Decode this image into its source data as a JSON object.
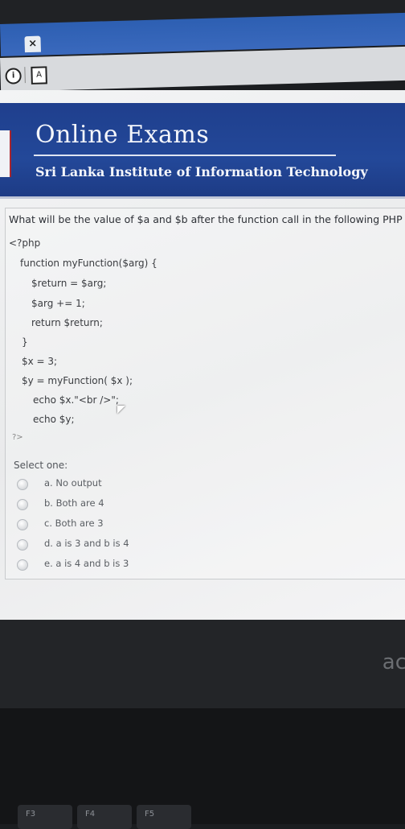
{
  "browser": {
    "tab_close": "×",
    "info_icon": "i",
    "page_icon": "A"
  },
  "banner": {
    "title": "Online Exams",
    "subtitle": "Sri Lanka Institute of Information Technology"
  },
  "question": {
    "text": "What will be the value of $a and $b after the function call in the following PHP",
    "code": [
      "<?php",
      "function myFunction($arg) {",
      "$return = $arg;",
      "$arg += 1;",
      "return $return;",
      "}",
      "$x = 3;",
      "$y = myFunction( $x );",
      "echo $x.\"<br />\";",
      "echo $y;",
      "?>"
    ],
    "select_label": "Select one:",
    "options": [
      "a. No output",
      "b. Both are 4",
      "c. Both are 3",
      "d. a is 3 and b is 4",
      "e. a is 4 and b is 3"
    ]
  },
  "device": {
    "brand": "ac",
    "keys": [
      "F3",
      "F4",
      "F5"
    ]
  }
}
